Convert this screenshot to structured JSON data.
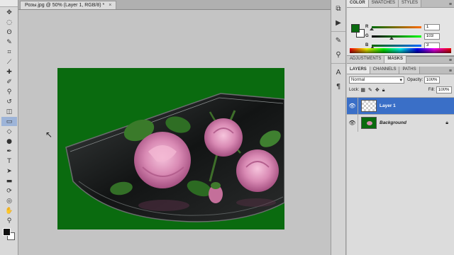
{
  "document": {
    "tab_title": "Розы.jpg @ 50% (Layer 1, RGB/8) *",
    "close_glyph": "×"
  },
  "tools": [
    {
      "name": "move-tool",
      "glyph": "✥"
    },
    {
      "name": "marquee-tool",
      "glyph": "◌"
    },
    {
      "name": "lasso-tool",
      "glyph": "ʘ"
    },
    {
      "name": "quick-select-tool",
      "glyph": "✎"
    },
    {
      "name": "crop-tool",
      "glyph": "⌗"
    },
    {
      "name": "eyedropper-tool",
      "glyph": "⟋"
    },
    {
      "name": "healing-tool",
      "glyph": "✚"
    },
    {
      "name": "brush-tool",
      "glyph": "✐"
    },
    {
      "name": "clone-stamp-tool",
      "glyph": "⚲"
    },
    {
      "name": "history-brush-tool",
      "glyph": "↺"
    },
    {
      "name": "eraser-tool",
      "glyph": "◫"
    },
    {
      "name": "gradient-tool",
      "glyph": "▭"
    },
    {
      "name": "blur-tool",
      "glyph": "◇"
    },
    {
      "name": "dodge-tool",
      "glyph": "●"
    },
    {
      "name": "pen-tool",
      "glyph": "✒"
    },
    {
      "name": "type-tool",
      "glyph": "T"
    },
    {
      "name": "path-select-tool",
      "glyph": "➤"
    },
    {
      "name": "shape-tool",
      "glyph": "▬"
    },
    {
      "name": "3d-rotate-tool",
      "glyph": "⟳"
    },
    {
      "name": "3d-orbit-tool",
      "glyph": "◎"
    },
    {
      "name": "hand-tool",
      "glyph": "✋"
    },
    {
      "name": "zoom-tool",
      "glyph": "⚲"
    }
  ],
  "color_panel": {
    "tabs": [
      "COLOR",
      "SWATCHES",
      "STYLES"
    ],
    "foreground": "#0a6b0f",
    "background": "#ffffff",
    "channels": [
      {
        "label": "R",
        "value": "1",
        "fraction": 0.004
      },
      {
        "label": "G",
        "value": "103",
        "fraction": 0.404
      },
      {
        "label": "B",
        "value": "3",
        "fraction": 0.012
      }
    ]
  },
  "adjustments_panel": {
    "tabs": [
      "ADJUSTMENTS",
      "MASKS"
    ]
  },
  "layers_panel": {
    "tabs": [
      "LAYERS",
      "CHANNELS",
      "PATHS"
    ],
    "blend_mode": "Normal",
    "opacity_label": "Opacity:",
    "opacity_value": "100%",
    "lock_label": "Lock:",
    "fill_label": "Fill:",
    "fill_value": "100%",
    "layers": [
      {
        "name": "Layer 1",
        "selected": true
      },
      {
        "name": "Background",
        "selected": false
      }
    ]
  },
  "colors": {
    "canvas_green": "#0a6b0f",
    "selection_blue": "#3a6fc7"
  }
}
